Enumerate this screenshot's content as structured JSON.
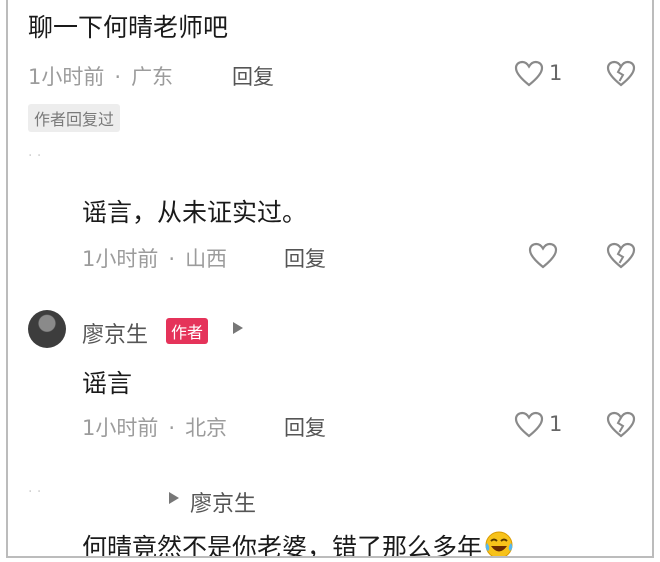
{
  "comment1": {
    "text": "聊一下何晴老师吧",
    "time": "1小时前",
    "location": "广东",
    "reply_label": "回复",
    "likes": "1",
    "tag": "作者回复过"
  },
  "comment2": {
    "text": "谣言，从未证实过。",
    "time": "1小时前",
    "location": "山西",
    "reply_label": "回复"
  },
  "comment3": {
    "username": "廖京生",
    "badge": "作者",
    "text": "谣言",
    "time": "1小时前",
    "location": "北京",
    "reply_label": "回复",
    "likes": "1"
  },
  "comment4": {
    "reply_to": "廖京生",
    "text": "何晴竟然不是你老婆，错了那么多年"
  },
  "separator_dot": "·",
  "icons": {
    "like": "heart-outline-icon",
    "dislike": "broken-heart-icon",
    "arrow": "right-triangle-icon",
    "emoji": "laughing-crying-emoji-icon"
  }
}
